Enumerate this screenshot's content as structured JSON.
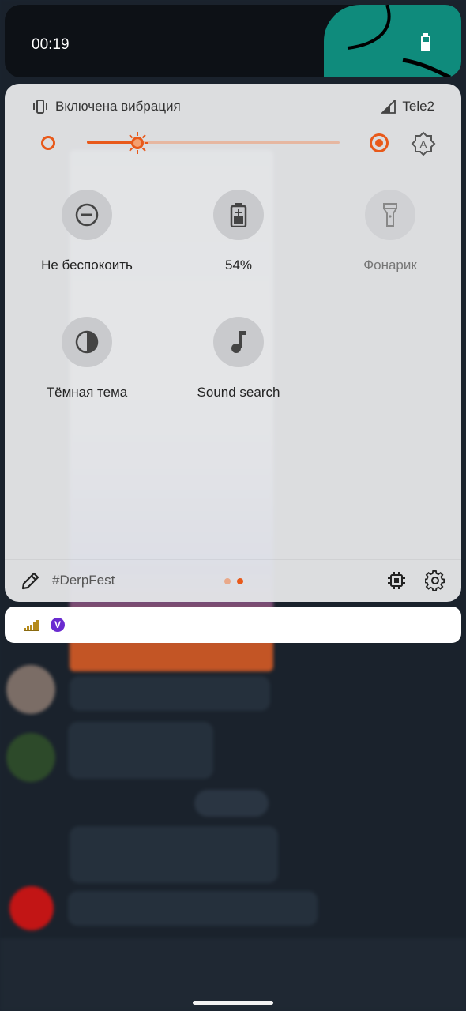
{
  "status_bar": {
    "time": "00:19"
  },
  "quick_settings": {
    "ringer_label": "Включена вибрация",
    "carrier": "Tele2",
    "brightness": {
      "level": 0.2
    },
    "tiles": [
      {
        "label": "Не беспокоить",
        "icon": "do-not-disturb-icon",
        "active": true
      },
      {
        "label": "54%",
        "icon": "battery-saver-icon",
        "active": true
      },
      {
        "label": "Фонарик",
        "icon": "flashlight-icon",
        "active": false
      },
      {
        "label": "Тёмная тема",
        "icon": "dark-theme-icon",
        "active": true
      },
      {
        "label": "Sound search",
        "icon": "music-note-icon",
        "active": true
      }
    ],
    "footer": {
      "build_label": "#DerpFest",
      "page_count": 2,
      "current_page": 2
    }
  },
  "notification_bar": {
    "icons": [
      "equalizer-icon",
      "viber-icon"
    ],
    "viber_letter": "V"
  },
  "colors": {
    "accent": "#e8591a",
    "panel": "#e4e5e7",
    "wallpaper": "#0f8b7c",
    "viber": "#6a2bd0"
  }
}
